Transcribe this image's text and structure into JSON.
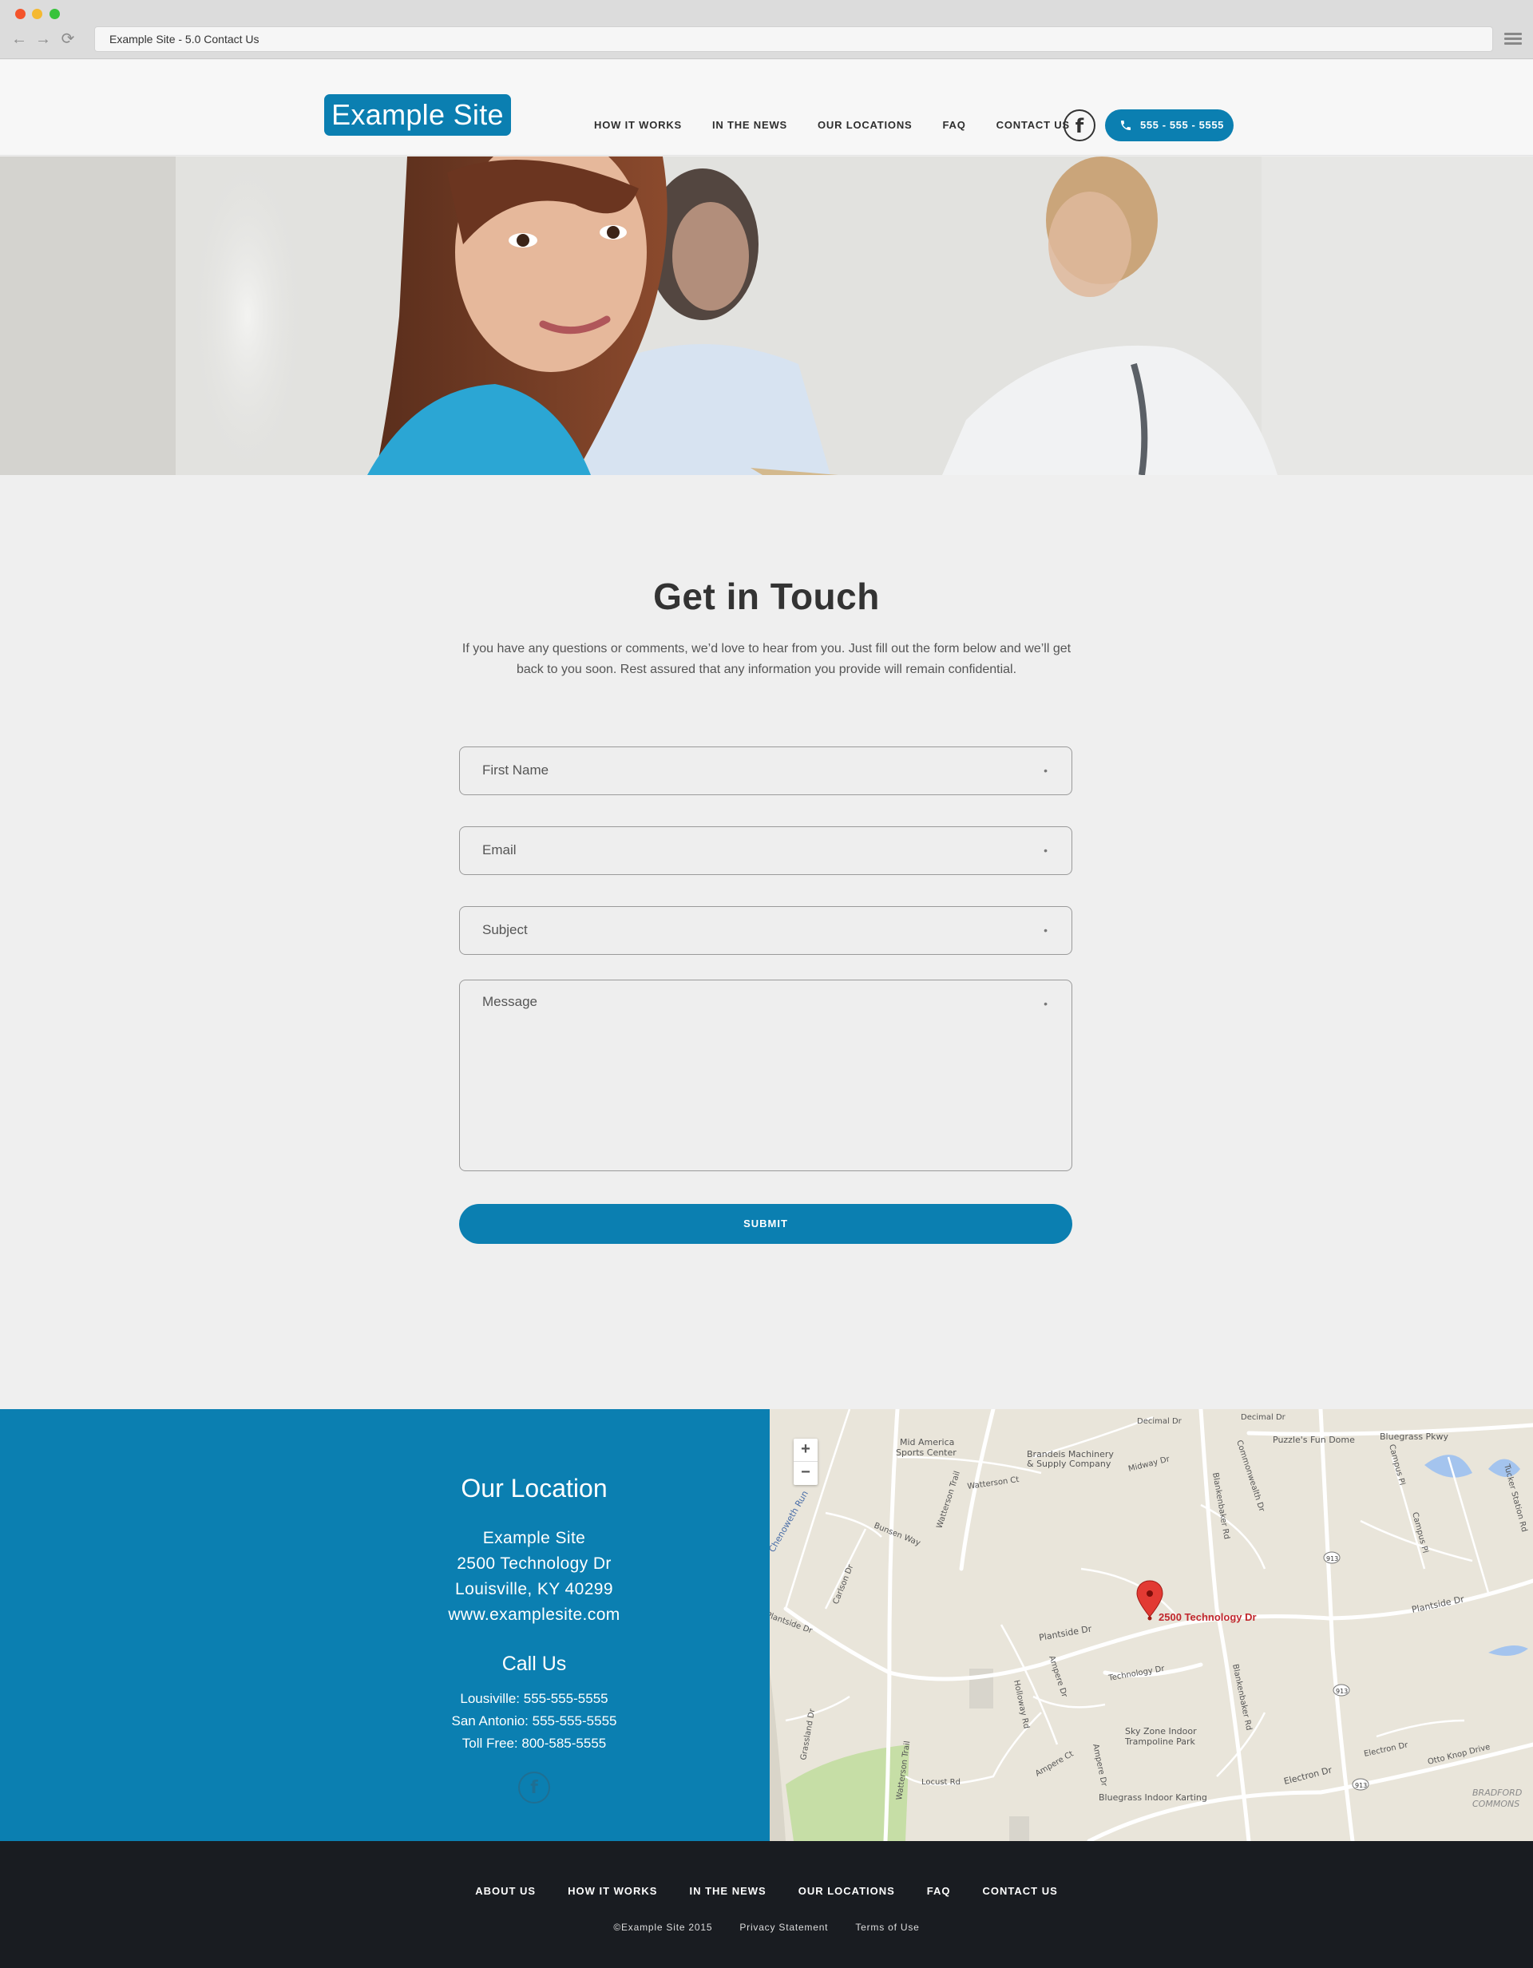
{
  "browser": {
    "url_title": "Example Site - 5.0 Contact Us",
    "back_icon": "←",
    "forward_icon": "→",
    "reload_icon": "⟳"
  },
  "header": {
    "logo": "Example Site",
    "nav": [
      "HOW IT WORKS",
      "IN THE NEWS",
      "OUR LOCATIONS",
      "FAQ",
      "CONTACT US"
    ],
    "facebook_icon": "f",
    "phone": "555 - 555 - 5555"
  },
  "main": {
    "title": "Get in Touch",
    "intro": "If you have any questions or comments, we’d love to hear from you. Just fill out the form below and we’ll get back to you soon. Rest assured that any information you provide will remain confidential.",
    "fields": {
      "first_name": "First Name",
      "email": "Email",
      "subject": "Subject",
      "message": "Message",
      "required_marker": "•"
    },
    "submit_label": "SUBMIT"
  },
  "location": {
    "title": "Our Location",
    "name": "Example Site",
    "street": "2500 Technology Dr",
    "city": "Louisville, KY 40299",
    "website": "www.examplesite.com",
    "call_title": "Call Us",
    "calls": [
      "Lousiville: 555-555-5555",
      "San Antonio: 555-555-5555",
      "Toll Free: 800-585-5555"
    ],
    "facebook_icon": "f"
  },
  "map": {
    "zoom_in": "+",
    "zoom_out": "−",
    "pin_label": "2500 Technology Dr",
    "labels": {
      "mid_america": "Mid America",
      "sports_center": "Sports Center",
      "brandeis1": "Brandeis Machinery",
      "brandeis2": "& Supply Company",
      "decimal_dr": "Decimal Dr",
      "decimal_dr2": "Decimal Dr",
      "puzzles": "Puzzle's Fun Dome",
      "bluegrass_pkwy": "Bluegrass Pkwy",
      "midway_dr": "Midway Dr",
      "watterson_ct": "Watterson Ct",
      "watterson_trail": "Watterson Trail",
      "watterson_trail2": "Watterson Trail",
      "bunsen_way": "Bunsen Way",
      "carlson_dr": "Carlson Dr",
      "chenoweth_run": "Chenoweth Run",
      "plantside_dr": "Plantside Dr",
      "plantside_dr2": "Plantside Dr",
      "plantside_dr3": "Plantside Dr",
      "technology_dr": "Technology Dr",
      "blankenbaker_rd": "Blankenbaker Rd",
      "blankenbaker_rd2": "Blankenbaker Rd",
      "commonwealth_dr": "Commonwealth Dr",
      "campus_pl": "Campus Pl",
      "campus_pl2": "Campus Pl",
      "tucker_station": "Tucker Station Rd",
      "hollowway_rd": "Holloway Rd",
      "ampere_dr": "Ampere Dr",
      "ampere_ct": "Ampere Ct",
      "ampere_dr2": "Ampere Dr",
      "grassland_dr": "Grassland Dr",
      "locust_rd": "Locust Rd",
      "sky_zone1": "Sky Zone Indoor",
      "sky_zone2": "Trampoline Park",
      "karting": "Bluegrass Indoor Karting",
      "electron_dr": "Electron Dr",
      "electron_dr2": "Electron Dr",
      "otto_knop": "Otto Knop Drive",
      "bradford1": "BRADFORD",
      "bradford2": "COMMONS",
      "route913": "913"
    }
  },
  "footer": {
    "nav": [
      "ABOUT US",
      "HOW IT WORKS",
      "IN THE NEWS",
      "OUR LOCATIONS",
      "FAQ",
      "CONTACT US"
    ],
    "copyright": "©Example Site 2015",
    "privacy": "Privacy Statement",
    "terms": "Terms of Use"
  },
  "colors": {
    "brand_blue": "#0b7fb1",
    "footer_dark": "#191c21",
    "page_bg": "#efefef"
  }
}
